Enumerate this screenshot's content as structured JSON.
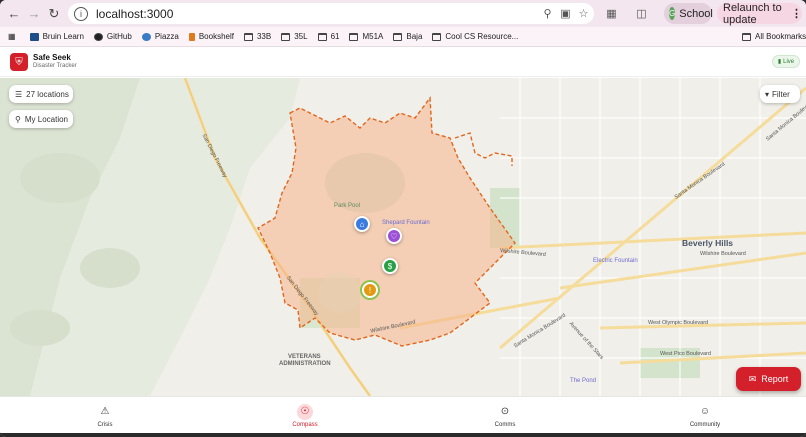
{
  "browser": {
    "url": "localhost:3000",
    "profile_label": "School",
    "profile_initial": "G",
    "relaunch_label": "Relaunch to update",
    "bookmarks": [
      "Bruin Learn",
      "GitHub",
      "Piazza",
      "Bookshelf",
      "33B",
      "35L",
      "61",
      "M51A",
      "Baja",
      "Cool CS Resource..."
    ],
    "all_bookmarks_label": "All Bookmarks"
  },
  "app": {
    "title": "Safe Seek",
    "subtitle": "Disaster Tracker",
    "live_label": "Live"
  },
  "map": {
    "locations_label": "27 locations",
    "my_location_label": "My Location",
    "filter_label": "Filter",
    "place_labels": {
      "beverly_hills": "Beverly Hills",
      "park_pool": "Park Pool",
      "shepard_fountain": "Shepard Fountain",
      "electric_fountain": "Electric Fountain",
      "veterans": "VETERANS",
      "administration": "ADMINISTRATION",
      "the_pond": "The Pond"
    },
    "road_labels": {
      "wilshire_blvd_1": "Wilshire Boulevard",
      "wilshire_blvd_2": "Wilshire Boulevard",
      "wilshire_blvd_3": "Wilshire Boulevard",
      "santa_monica_blvd_1": "Santa Monica Boulevard",
      "santa_monica_blvd_2": "Santa Monica Boulevard",
      "santa_monica_blvd_3": "Santa Monica Boulevard",
      "west_olympic_blvd": "West Olympic Boulevard",
      "west_pico_blvd": "West Pico Boulevard",
      "san_diego_fwy_1": "San Diego Freeway",
      "san_diego_fwy_2": "San Diego Freeway",
      "avenue_of_stars": "Avenue of the Stars"
    },
    "report_label": "Report",
    "colors": {
      "zone_fill": "#f6b48a",
      "zone_stroke": "#e0671e",
      "pin_home": "#3b7be0",
      "pin_heart": "#9b4fd6",
      "pin_money": "#27a045",
      "pin_alert": "#e39a12"
    }
  },
  "nav": {
    "tabs": [
      {
        "label": "Crisis"
      },
      {
        "label": "Compass"
      },
      {
        "label": "Comms"
      },
      {
        "label": "Community"
      }
    ]
  }
}
